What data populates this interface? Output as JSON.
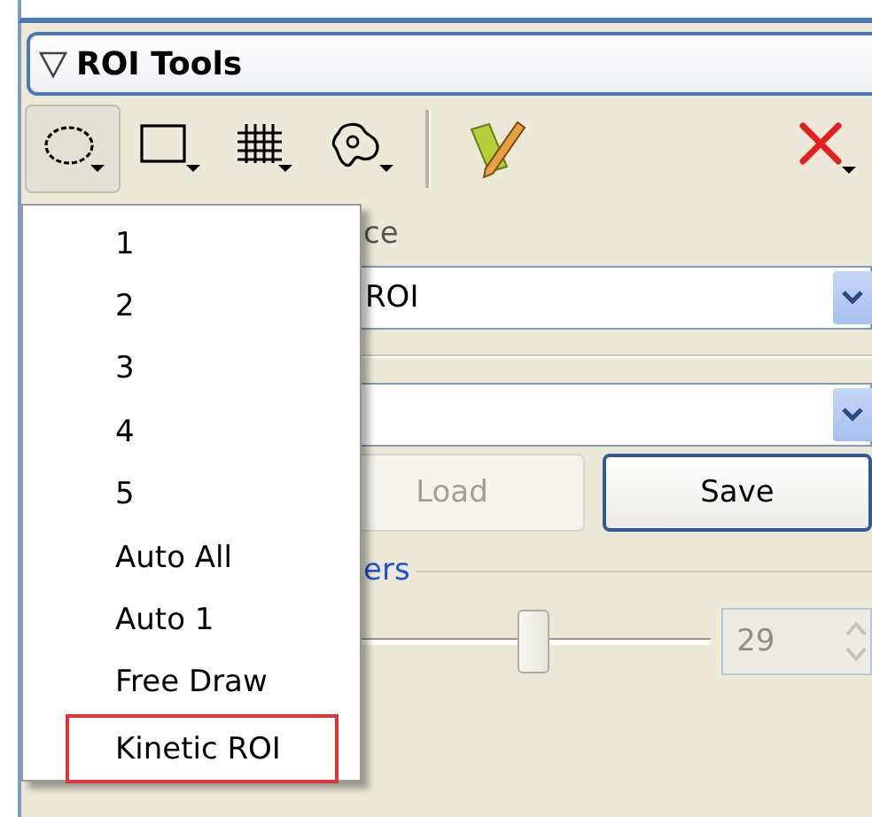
{
  "panel": {
    "title": "ROI Tools",
    "expanded": true
  },
  "toolbar": [
    {
      "kind": "ellipse",
      "pressed": true
    },
    {
      "kind": "rectangle",
      "pressed": false
    },
    {
      "kind": "grid",
      "pressed": false
    },
    {
      "kind": "lasso",
      "pressed": false
    },
    {
      "kind": "separator"
    },
    {
      "kind": "ruler",
      "pressed": false
    },
    {
      "kind": "delete",
      "pressed": false
    }
  ],
  "section_label": "ce",
  "combos": [
    {
      "kind": "dropdown",
      "value": "ROI"
    },
    {
      "kind": "dropdown"
    }
  ],
  "buttons": [
    {
      "label": "Load",
      "disabled": true
    },
    {
      "label": "Save",
      "disabled": false
    }
  ],
  "group_label": "ers",
  "slider": {
    "level": 0.55
  },
  "spinbox": {
    "value": "29",
    "disabled": true
  },
  "menu": {
    "items": [
      {
        "label": "1",
        "selected": false
      },
      {
        "label": "2",
        "selected": false
      },
      {
        "label": "3",
        "selected": false
      },
      {
        "label": "4",
        "selected": false
      },
      {
        "label": "5",
        "selected": false
      },
      {
        "label": "Auto All",
        "selected": false
      },
      {
        "label": "Auto 1",
        "selected": false
      },
      {
        "label": "Free Draw",
        "selected": false
      },
      {
        "label": "Kinetic ROI",
        "selected": true
      }
    ]
  }
}
